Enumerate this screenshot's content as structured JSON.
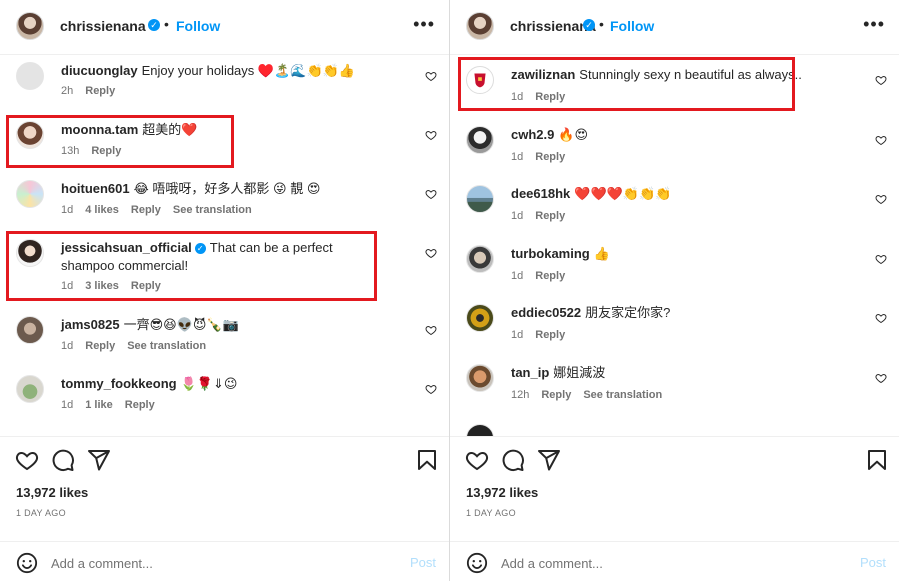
{
  "left": {
    "header": {
      "username": "chrissienana",
      "dot": "•",
      "follow": "Follow",
      "more": "•••"
    },
    "comments": [
      {
        "user": "diucuonglay",
        "text": "Enjoy your holidays ♥️🏝️🌊👏👏👍",
        "time": "2h",
        "likes": "",
        "reply": "Reply",
        "translate": ""
      },
      {
        "user": "moonna.tam",
        "text": "超美的❤️",
        "time": "13h",
        "likes": "",
        "reply": "Reply",
        "translate": ""
      },
      {
        "user": "hoituen601",
        "text": "😂 唔哦呀，好多人都影 😜 靚 😍",
        "time": "1d",
        "likes": "4 likes",
        "reply": "Reply",
        "translate": "See translation"
      },
      {
        "user": "jessicahsuan_official",
        "text": "That can be a perfect shampoo commercial!",
        "time": "1d",
        "likes": "3 likes",
        "reply": "Reply",
        "translate": ""
      },
      {
        "user": "jams0825",
        "text": "一齊😎😆👽😈🍾📷",
        "time": "1d",
        "likes": "",
        "reply": "Reply",
        "translate": "See translation"
      },
      {
        "user": "tommy_fookkeong",
        "text": "🌷🌹⇓😉",
        "time": "1d",
        "likes": "1 like",
        "reply": "Reply",
        "translate": ""
      }
    ],
    "likes_count": "13,972 likes",
    "date": "1 DAY AGO",
    "input_placeholder": "Add a comment...",
    "post_label": "Post"
  },
  "right": {
    "header": {
      "username": "chrissienana",
      "dot": "•",
      "follow": "Follow",
      "more": "•••"
    },
    "comments": [
      {
        "user": "zawiliznan",
        "text": "Stunningly sexy n beautiful as always..",
        "time": "1d",
        "likes": "",
        "reply": "Reply",
        "translate": ""
      },
      {
        "user": "cwh2.9",
        "text": "🔥😍",
        "time": "1d",
        "likes": "",
        "reply": "Reply",
        "translate": ""
      },
      {
        "user": "dee618hk",
        "text": "❤️❤️❤️👏👏👏",
        "time": "1d",
        "likes": "",
        "reply": "Reply",
        "translate": ""
      },
      {
        "user": "turbokaming",
        "text": "👍",
        "time": "1d",
        "likes": "",
        "reply": "Reply",
        "translate": ""
      },
      {
        "user": "eddiec0522",
        "text": "朋友家定你家?",
        "time": "1d",
        "likes": "",
        "reply": "Reply",
        "translate": ""
      },
      {
        "user": "tan_ip",
        "text": "娜姐減波",
        "time": "12h",
        "likes": "",
        "reply": "Reply",
        "translate": "See translation"
      }
    ],
    "likes_count": "13,972 likes",
    "date": "1 DAY AGO",
    "input_placeholder": "Add a comment...",
    "post_label": "Post"
  },
  "colors": {
    "accent": "#0095f6",
    "highlight": "#e3191f",
    "meta": "#737373",
    "text": "#262626"
  },
  "icons": [
    "heart-icon",
    "comment-icon",
    "share-icon",
    "bookmark-icon",
    "emoji-icon",
    "verified-icon",
    "more-icon"
  ]
}
